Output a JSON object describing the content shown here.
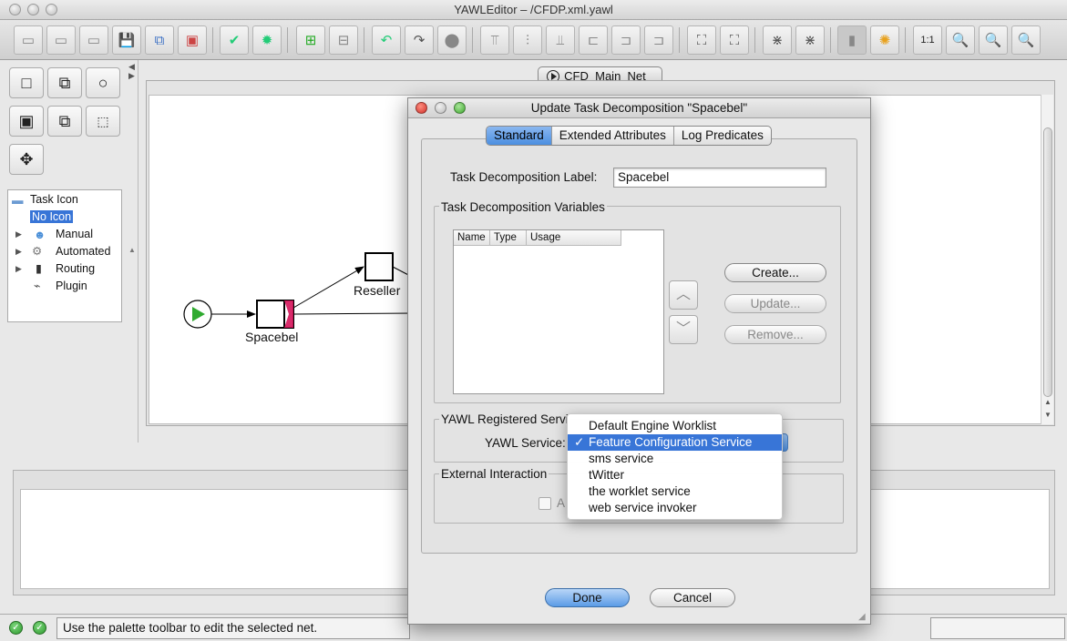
{
  "window": {
    "title": "YAWLEditor – /CFDP.xml.yawl"
  },
  "net_tab": {
    "label": "CFD_Main_Net_"
  },
  "palette": {
    "tree_root": "Task Icon",
    "tree_items": [
      "No Icon",
      "Manual",
      "Automated",
      "Routing",
      "Plugin"
    ]
  },
  "canvas": {
    "task_spacebel": "Spacebel",
    "task_reseller": "Reseller"
  },
  "status": {
    "message": "Use the palette toolbar to edit the selected net."
  },
  "dialog": {
    "title": "Update Task Decomposition  \"Spacebel\"",
    "tabs": [
      "Standard",
      "Extended Attributes",
      "Log Predicates"
    ],
    "label_caption": "Task Decomposition Label:",
    "label_value": "Spacebel",
    "variables_group": "Task Decomposition Variables",
    "columns": [
      "Name",
      "Type",
      "Usage"
    ],
    "create_button": "Create...",
    "update_button": "Update...",
    "remove_button": "Remove...",
    "services_group": "YAWL Registered Servi",
    "service_caption": "YAWL Service:",
    "external_group": "External Interaction",
    "external_check_label": "A",
    "done_button": "Done",
    "cancel_button": "Cancel"
  },
  "service_dropdown": {
    "options": [
      "Default Engine Worklist",
      "Feature Configuration Service",
      "sms service",
      "tWitter",
      "the worklet service",
      "web service invoker"
    ],
    "selected": "Feature Configuration Service"
  },
  "colors": {
    "selection": "#3875d7",
    "start_condition": "#2faa2f"
  }
}
